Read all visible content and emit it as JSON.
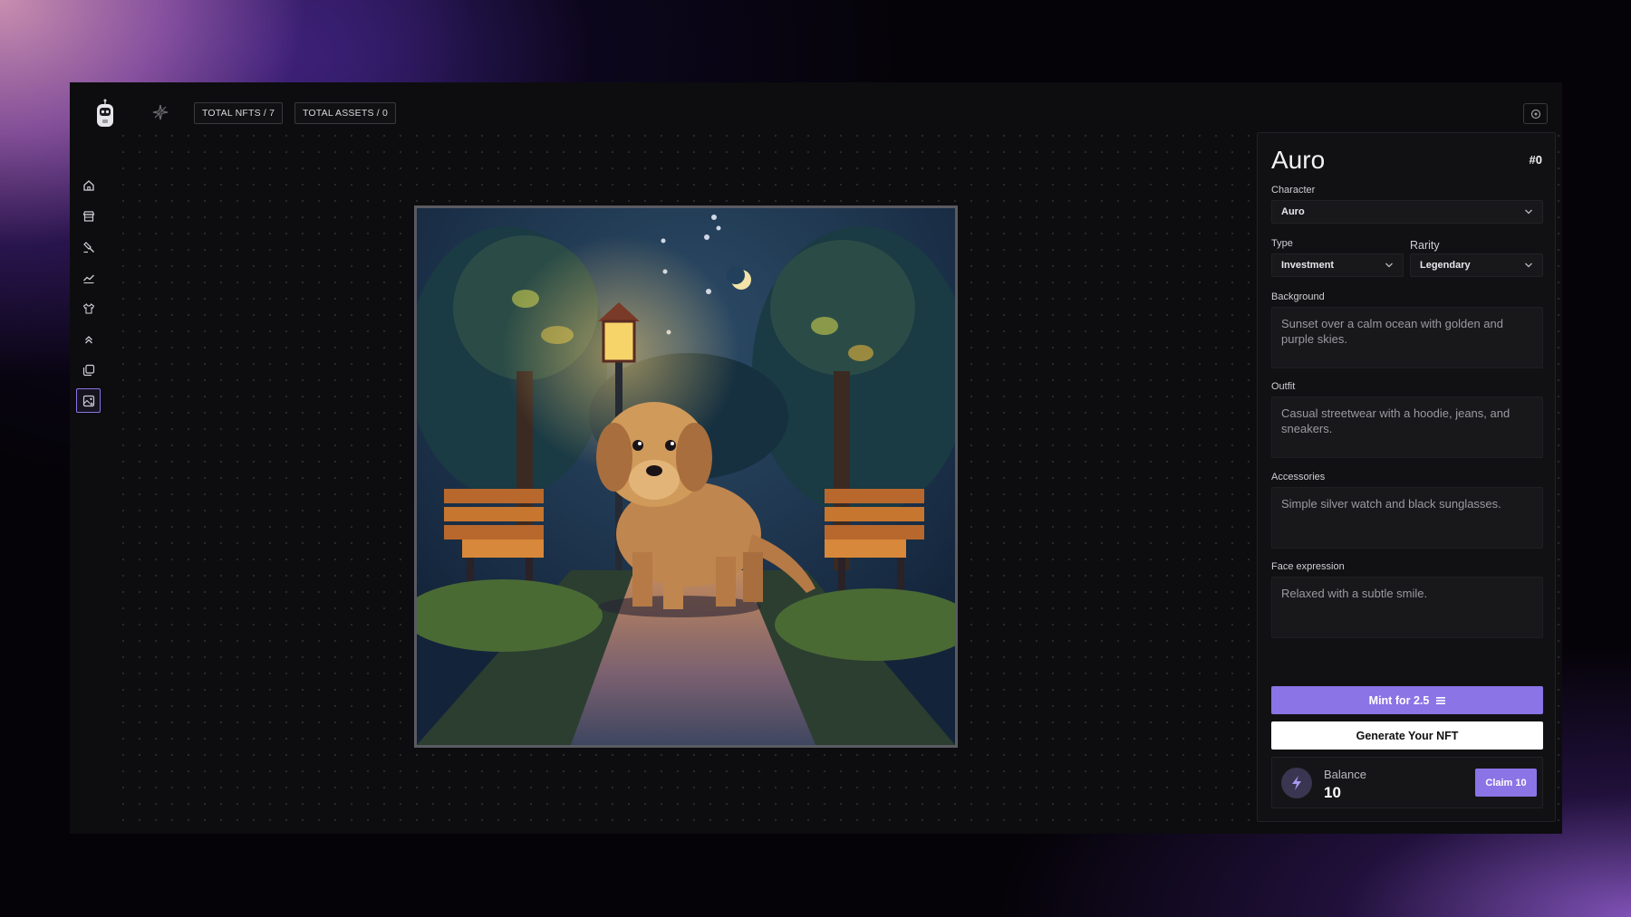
{
  "header": {
    "total_nfts": "TOTAL NFTS / 7",
    "total_assets": "TOTAL ASSETS / 0"
  },
  "sidebar": {
    "items": [
      {
        "icon": "home-icon"
      },
      {
        "icon": "store-icon"
      },
      {
        "icon": "hammer-icon"
      },
      {
        "icon": "chart-icon"
      },
      {
        "icon": "shirt-icon"
      },
      {
        "icon": "chevrons-up-icon"
      },
      {
        "icon": "layers-icon"
      },
      {
        "icon": "image-generate-icon",
        "active": true
      }
    ]
  },
  "panel": {
    "title": "Auro",
    "id": "#0",
    "character_label": "Character",
    "character_value": "Auro",
    "type_label": "Type",
    "type_value": "Investment",
    "rarity_label": "Rarity",
    "rarity_value": "Legendary",
    "background_label": "Background",
    "background_value": "Sunset over a calm ocean with golden and purple skies.",
    "outfit_label": "Outfit",
    "outfit_value": "Casual streetwear with a hoodie, jeans, and sneakers.",
    "accessories_label": "Accessories",
    "accessories_value": "Simple silver watch and black sunglasses.",
    "face_label": "Face expression",
    "face_value": "Relaxed with a subtle smile.",
    "mint_label": "Mint for 2.5",
    "generate_label": "Generate Your NFT",
    "balance_label": "Balance",
    "balance_value": "10",
    "claim_label": "Claim 10"
  },
  "colors": {
    "accent": "#8b74e6",
    "panel_bg": "#111113",
    "app_bg": "#0d0d0f"
  }
}
